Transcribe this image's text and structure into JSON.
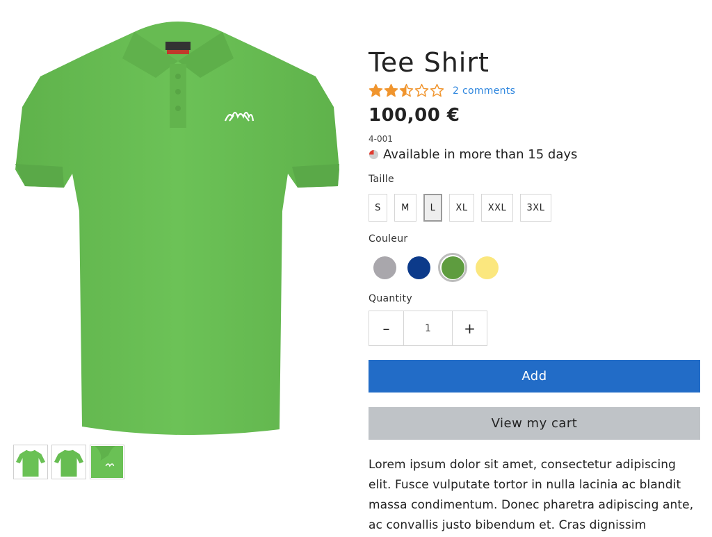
{
  "product": {
    "title": "Tee Shirt",
    "rating": 2.5,
    "rating_max": 5,
    "comments_link": "2 comments",
    "price": "100,00 €",
    "sku": "4-001",
    "availability": "Available in more than 15 days",
    "description": "Lorem ipsum dolor sit amet, consectetur adipiscing elit. Fusce vulputate tortor in nulla lacinia ac blandit massa condimentum. Donec pharetra adipiscing ante, ac convallis justo bibendum et. Cras dignissim"
  },
  "size_selector": {
    "label": "Taille",
    "options": [
      "S",
      "M",
      "L",
      "XL",
      "XXL",
      "3XL"
    ],
    "selected": "L"
  },
  "color_selector": {
    "label": "Couleur",
    "options": [
      "#a9a7ac",
      "#0c3a8a",
      "#5e9c3f",
      "#fbe77e"
    ],
    "selected_index": 2
  },
  "quantity": {
    "label": "Quantity",
    "value": "1",
    "decrement_symbol": "–",
    "increment_symbol": "+"
  },
  "buttons": {
    "add": "Add",
    "view_cart": "View my cart"
  },
  "gallery": {
    "thumbnails": [
      "front-view",
      "back-view",
      "detail-view"
    ]
  },
  "colors": {
    "star_fill": "#f0952e",
    "link": "#2e86de",
    "add_button": "#226cc7",
    "cart_button": "#bfc3c7",
    "availability_dot": "#e03c31",
    "shirt": "#6ac155"
  }
}
